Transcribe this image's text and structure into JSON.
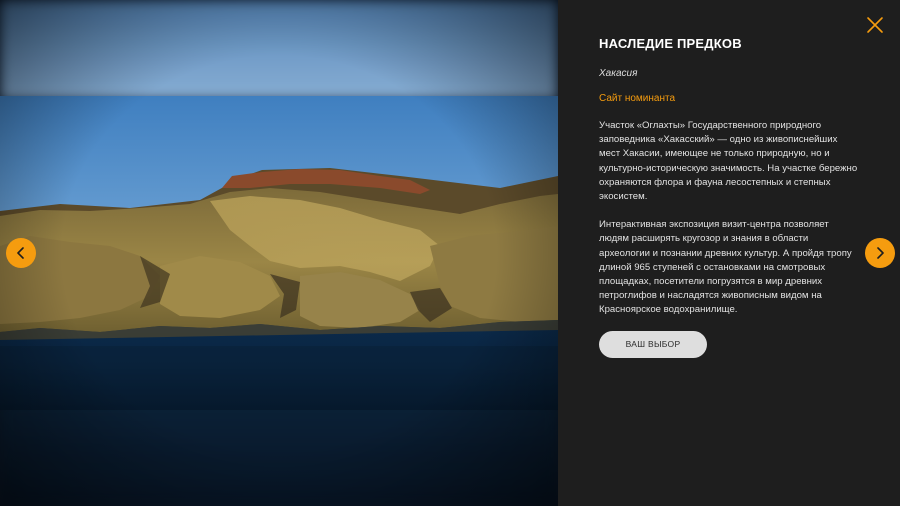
{
  "gallery": {
    "photo_alt": "Участок «Оглахты»",
    "prev_icon": "chevron-left-icon",
    "next_icon": "chevron-right-icon",
    "accent_color": "#f59c0f"
  },
  "panel": {
    "close_icon": "close-icon",
    "title": "НАСЛЕДИЕ ПРЕДКОВ",
    "region": "Хакасия",
    "site_link": "Сайт номинанта",
    "paragraphs": [
      "Участок «Оглахты» Государственного природного заповедника «Хакасский» — одно из живописнейших мест Хакасии, имеющее не только природную, но и культурно-историческую значимость. На участке бережно охраняются флора и фауна лесостепных и степных экосистем.",
      "Интерактивная экспозиция визит-центра позволяет людям расширять кругозор и знания в области археологии и познании древних культур. А пройдя тропу длиной 965 ступеней с остановками на смотровых площадках, посетители погрузятся в мир древних петроглифов и насладятся живописным видом на Красноярское водохранилище."
    ],
    "vote_button": "ВАШ ВЫБОР"
  }
}
